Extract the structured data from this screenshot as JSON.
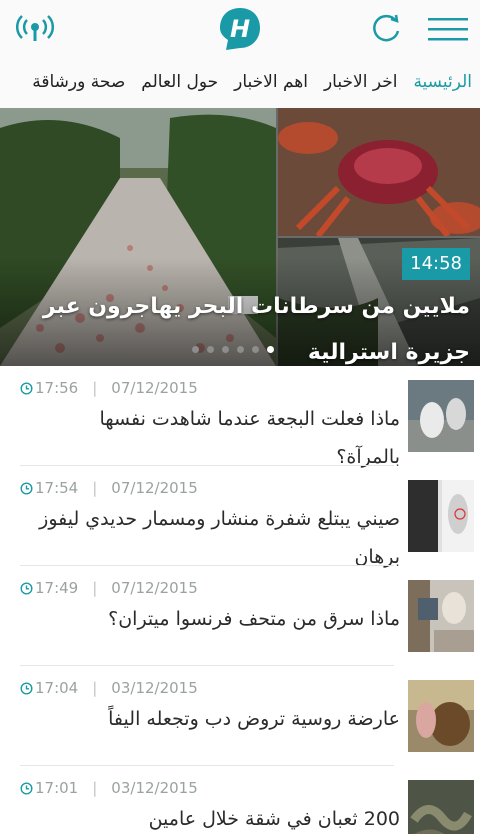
{
  "colors": {
    "accent": "#1a9aa6",
    "hero_badge": "#1a9aa6",
    "meta_text": "#9aa2a2"
  },
  "header": {
    "live_icon": "radio-broadcast-icon",
    "logo_icon": "brand-logo-h-icon",
    "refresh_icon": "refresh-icon",
    "menu_icon": "hamburger-menu-icon"
  },
  "nav": {
    "tabs": [
      {
        "label": "الرئيسية",
        "active": true
      },
      {
        "label": "اخر الاخبار",
        "active": false
      },
      {
        "label": "اهم الاخبار",
        "active": false
      },
      {
        "label": "حول العالم",
        "active": false
      },
      {
        "label": "صحة ورشاقة",
        "active": false
      }
    ]
  },
  "hero": {
    "time": "14:58",
    "title": "ملايين من سرطانات البحر يهاجرون عبر جزيرة استرالية",
    "dots_total": 6,
    "dots_active": 0
  },
  "articles": [
    {
      "time": "17:56",
      "date": "07/12/2015",
      "title": "ماذا فعلت البجعة عندما شاهدت نفسها بالمرآة؟"
    },
    {
      "time": "17:54",
      "date": "07/12/2015",
      "title": "صيني يبتلع شفرة منشار ومسمار حديدي ليفوز برهان"
    },
    {
      "time": "17:49",
      "date": "07/12/2015",
      "title": "ماذا سرق من متحف فرنسوا ميتران؟"
    },
    {
      "time": "17:04",
      "date": "03/12/2015",
      "title": "عارضة روسية تروض دب وتجعله اليفاً"
    },
    {
      "time": "17:01",
      "date": "03/12/2015",
      "title": "200 ثعبان في شقة خلال عامين"
    }
  ]
}
